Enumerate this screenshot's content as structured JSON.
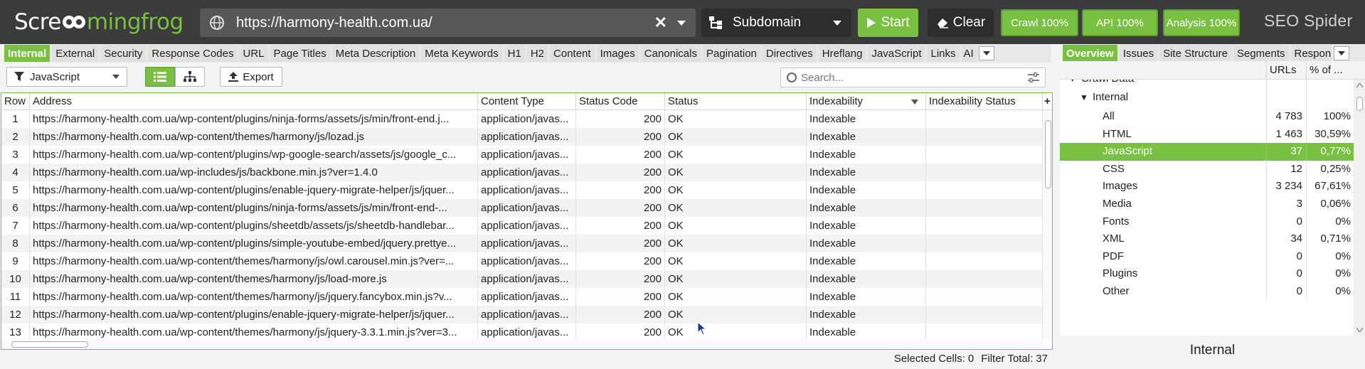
{
  "topbar": {
    "logo_left": "Scre",
    "logo_mid": "mingfrog",
    "url": "https://harmony-health.com.ua/",
    "mode": "Subdomain",
    "start_label": "Start",
    "clear_label": "Clear",
    "crawl_label": "Crawl 100%",
    "api_label": "API 100%",
    "analysis_label": "Analysis 100%",
    "product": "SEO Spider",
    "accent": "#7ac143"
  },
  "tabs": [
    "Internal",
    "External",
    "Security",
    "Response Codes",
    "URL",
    "Page Titles",
    "Meta Description",
    "Meta Keywords",
    "H1",
    "H2",
    "Content",
    "Images",
    "Canonicals",
    "Pagination",
    "Directives",
    "Hreflang",
    "JavaScript",
    "Links",
    "AI"
  ],
  "right_tabs": [
    "Overview",
    "Issues",
    "Site Structure",
    "Segments",
    "Respon"
  ],
  "toolbar": {
    "filter": "JavaScript",
    "export_label": "Export",
    "search_placeholder": "Search..."
  },
  "table": {
    "columns": [
      "Row",
      "Address",
      "Content Type",
      "Status Code",
      "Status",
      "Indexability",
      "Indexability Status",
      "+"
    ],
    "rows": [
      [
        "1",
        "https://harmony-health.com.ua/wp-content/plugins/ninja-forms/assets/js/min/front-end.j...",
        "application/javas...",
        "200",
        "OK",
        "Indexable",
        ""
      ],
      [
        "2",
        "https://harmony-health.com.ua/wp-content/themes/harmony/js/lozad.js",
        "application/javas...",
        "200",
        "OK",
        "Indexable",
        ""
      ],
      [
        "3",
        "https://harmony-health.com.ua/wp-content/plugins/wp-google-search/assets/js/google_c...",
        "application/javas...",
        "200",
        "OK",
        "Indexable",
        ""
      ],
      [
        "4",
        "https://harmony-health.com.ua/wp-includes/js/backbone.min.js?ver=1.4.0",
        "application/javas...",
        "200",
        "OK",
        "Indexable",
        ""
      ],
      [
        "5",
        "https://harmony-health.com.ua/wp-content/plugins/enable-jquery-migrate-helper/js/jquer...",
        "application/javas...",
        "200",
        "OK",
        "Indexable",
        ""
      ],
      [
        "6",
        "https://harmony-health.com.ua/wp-content/plugins/ninja-forms/assets/js/min/front-end-...",
        "application/javas...",
        "200",
        "OK",
        "Indexable",
        ""
      ],
      [
        "7",
        "https://harmony-health.com.ua/wp-content/plugins/sheetdb/assets/js/sheetdb-handlebar...",
        "application/javas...",
        "200",
        "OK",
        "Indexable",
        ""
      ],
      [
        "8",
        "https://harmony-health.com.ua/wp-content/plugins/simple-youtube-embed/jquery.prettye...",
        "application/javas...",
        "200",
        "OK",
        "Indexable",
        ""
      ],
      [
        "9",
        "https://harmony-health.com.ua/wp-content/themes/harmony/js/owl.carousel.min.js?ver=...",
        "application/javas...",
        "200",
        "OK",
        "Indexable",
        ""
      ],
      [
        "10",
        "https://harmony-health.com.ua/wp-content/themes/harmony/js/load-more.js",
        "application/javas...",
        "200",
        "OK",
        "Indexable",
        ""
      ],
      [
        "11",
        "https://harmony-health.com.ua/wp-content/themes/harmony/js/jquery.fancybox.min.js?v...",
        "application/javas...",
        "200",
        "OK",
        "Indexable",
        ""
      ],
      [
        "12",
        "https://harmony-health.com.ua/wp-content/plugins/enable-jquery-migrate-helper/js/jquer...",
        "application/javas...",
        "200",
        "OK",
        "Indexable",
        ""
      ],
      [
        "13",
        "https://harmony-health.com.ua/wp-content/themes/harmony/js/jquery-3.3.1.min.js?ver=3...",
        "application/javas...",
        "200",
        "OK",
        "Indexable",
        ""
      ]
    ]
  },
  "status": {
    "selected_label": "Selected Cells:",
    "selected_value": "0",
    "filter_label": "Filter Total:",
    "filter_value": "37"
  },
  "overview": {
    "col_urls": "URLs",
    "col_pct": "% of ...",
    "clipped_top": "Crawl Data",
    "group": "Internal",
    "rows": [
      {
        "label": "All",
        "urls": "4 783",
        "pct": "100%"
      },
      {
        "label": "HTML",
        "urls": "1 463",
        "pct": "30,59%"
      },
      {
        "label": "JavaScript",
        "urls": "37",
        "pct": "0,77%"
      },
      {
        "label": "CSS",
        "urls": "12",
        "pct": "0,25%"
      },
      {
        "label": "Images",
        "urls": "3 234",
        "pct": "67,61%"
      },
      {
        "label": "Media",
        "urls": "3",
        "pct": "0,06%"
      },
      {
        "label": "Fonts",
        "urls": "0",
        "pct": "0%"
      },
      {
        "label": "XML",
        "urls": "34",
        "pct": "0,71%"
      },
      {
        "label": "PDF",
        "urls": "0",
        "pct": "0%"
      },
      {
        "label": "Plugins",
        "urls": "0",
        "pct": "0%"
      },
      {
        "label": "Other",
        "urls": "0",
        "pct": "0%"
      }
    ],
    "footer": "Internal"
  }
}
